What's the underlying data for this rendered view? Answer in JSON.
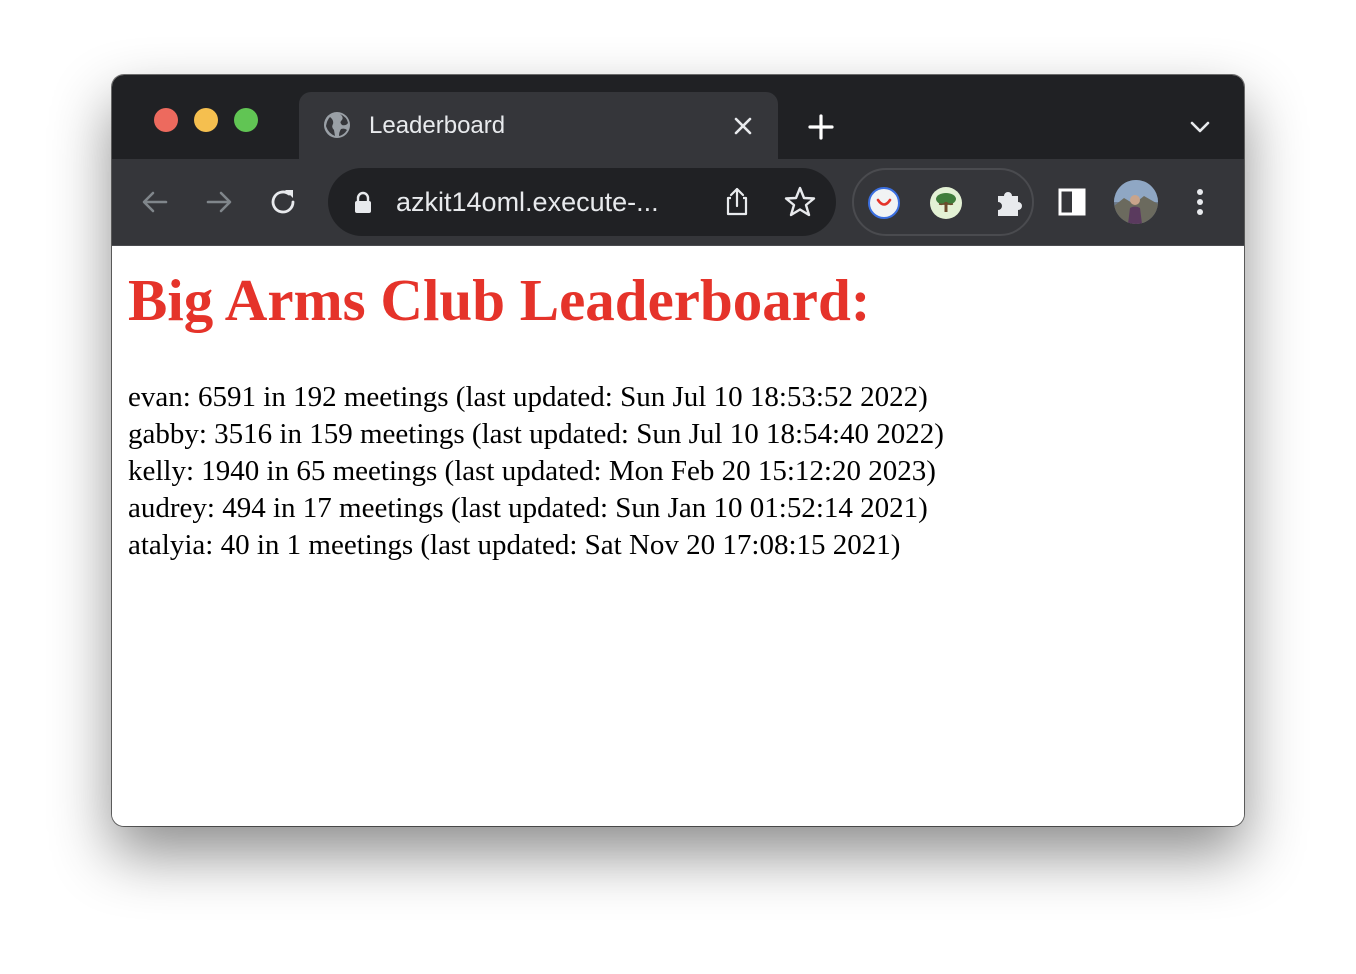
{
  "browser": {
    "tab_title": "Leaderboard",
    "url": "azkit14oml.execute-..."
  },
  "icons": [
    "globe-icon",
    "close-icon",
    "plus-icon",
    "chevron-down-icon",
    "back-arrow-icon",
    "forward-arrow-icon",
    "reload-icon",
    "lock-icon",
    "share-icon",
    "star-icon",
    "extension-icon",
    "tree-extension-icon",
    "puzzle-icon",
    "side-panel-icon",
    "avatar",
    "more-vertical-icon"
  ],
  "colors": {
    "title": "#e5332a",
    "chrome_dark": "#202124",
    "chrome_toolbar": "#35363a"
  },
  "page": {
    "title": "Big Arms Club Leaderboard:",
    "entries": [
      "evan: 6591 in 192 meetings (last updated: Sun Jul 10 18:53:52 2022)",
      "gabby: 3516 in 159 meetings (last updated: Sun Jul 10 18:54:40 2022)",
      "kelly: 1940 in 65 meetings (last updated: Mon Feb 20 15:12:20 2023)",
      "audrey: 494 in 17 meetings (last updated: Sun Jan 10 01:52:14 2021)",
      "atalyia: 40 in 1 meetings (last updated: Sat Nov 20 17:08:15 2021)"
    ]
  }
}
